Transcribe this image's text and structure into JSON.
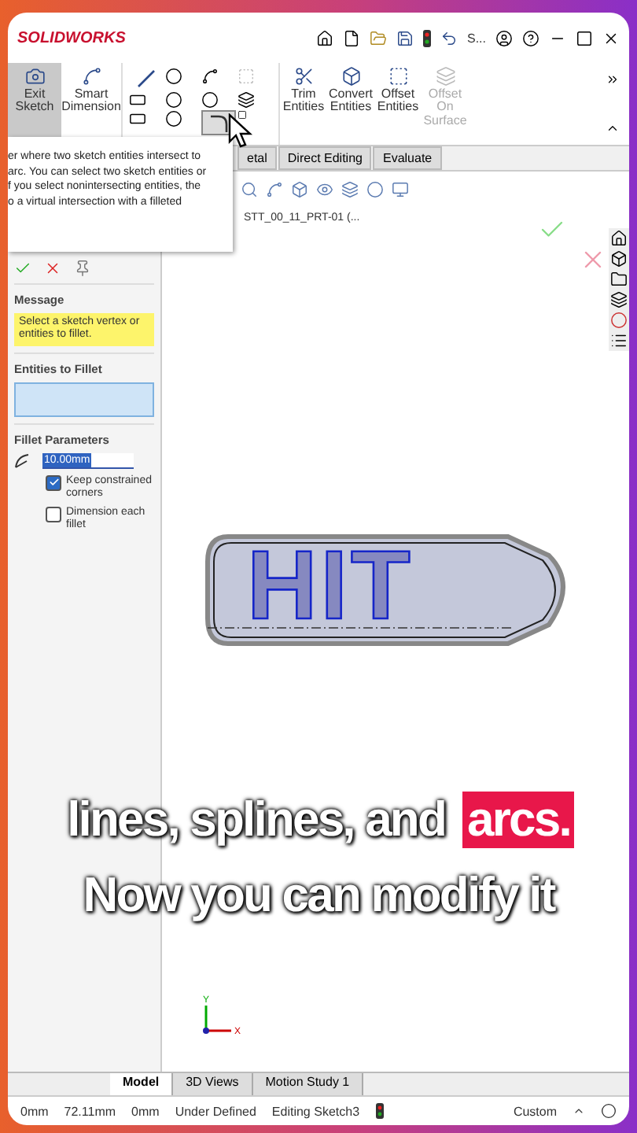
{
  "title_bar": {
    "logo": "SOLIDWORKS",
    "doc_title": "S..."
  },
  "ribbon": {
    "commands": [
      {
        "label": "Exit Sketch",
        "kind": "exit",
        "selected": true,
        "disabled": false
      },
      {
        "label": "Smart Dimension",
        "kind": "dimension",
        "selected": false,
        "disabled": false
      },
      {
        "label": "Trim Entities",
        "kind": "trim",
        "selected": false,
        "disabled": false
      },
      {
        "label": "Convert Entities",
        "kind": "convert",
        "selected": false,
        "disabled": false
      },
      {
        "label": "Offset Entities",
        "kind": "offset",
        "selected": false,
        "disabled": false
      },
      {
        "label": "Offset On Surface",
        "kind": "surface",
        "selected": false,
        "disabled": true
      }
    ]
  },
  "tabs": [
    {
      "label": "etal",
      "selected": false
    },
    {
      "label": "Direct Editing",
      "selected": false
    },
    {
      "label": "Evaluate",
      "selected": false
    }
  ],
  "tooltip": {
    "lines": [
      "er where two sketch entities intersect to",
      "arc. You can select two sketch entities or",
      "f you select nonintersecting entities, the",
      "o a virtual intersection with a filleted"
    ]
  },
  "property_manager": {
    "message_heading": "Message",
    "message": "Select a sketch vertex or entities to fillet.",
    "entities_heading": "Entities to Fillet",
    "params_heading": "Fillet Parameters",
    "radius": "10.00mm",
    "options": [
      {
        "label": "Keep constrained corners",
        "checked": true
      },
      {
        "label": "Dimension each fillet",
        "checked": false
      }
    ]
  },
  "viewport": {
    "tree_label": "STT_00_11_PRT-01 (...",
    "sketch_text": "HIT",
    "axis_y": "Y",
    "axis_x": "X"
  },
  "caption": {
    "lines": [
      {
        "parts": [
          {
            "text": "lines, splines, and",
            "highlight": false
          },
          {
            "text": "arcs.",
            "highlight": true
          }
        ]
      },
      {
        "parts": [
          {
            "text": "Now you can modify it",
            "highlight": false
          }
        ]
      }
    ]
  },
  "bottom_tabs": [
    {
      "label": "Model",
      "selected": true
    },
    {
      "label": "3D Views",
      "selected": false
    },
    {
      "label": "Motion Study 1",
      "selected": false
    }
  ],
  "status_bar": {
    "fields": [
      "0mm",
      "72.11mm",
      "0mm",
      "Under Defined",
      "Editing Sketch3"
    ],
    "units": "Custom"
  }
}
